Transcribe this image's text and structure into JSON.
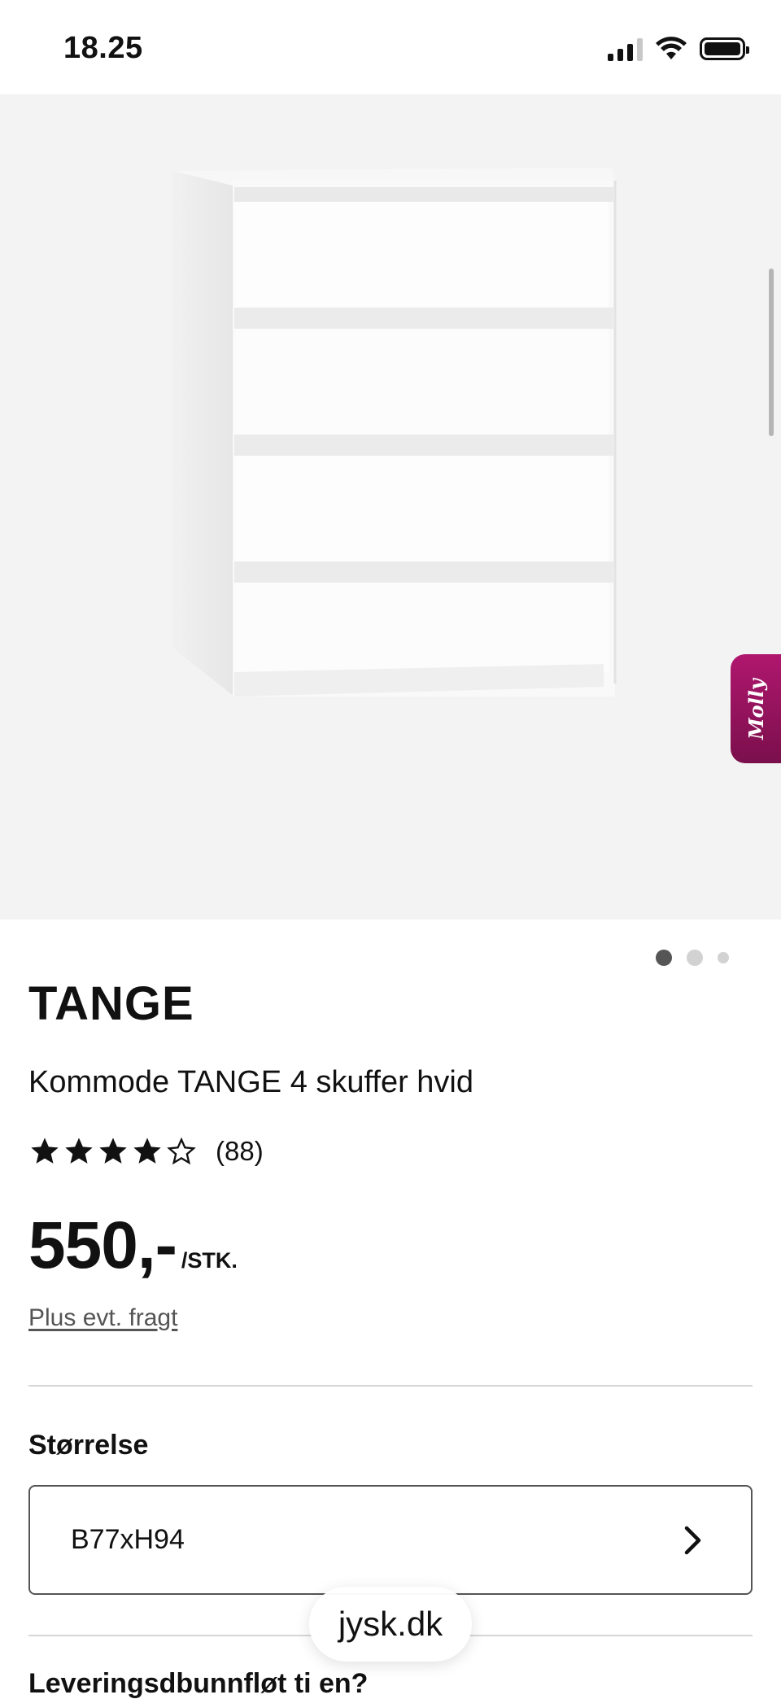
{
  "status_bar": {
    "time": "18.25",
    "battery_level": 1.0,
    "signal_bars_active": 3,
    "signal_bars_total": 4
  },
  "gallery": {
    "image_count": 3,
    "active_index": 0,
    "dot_colors": {
      "active": "#555555",
      "inactive": "#cfcfcf"
    },
    "chat_tab_label": "Molly",
    "chat_tab_color": "#9b1565"
  },
  "product": {
    "brand": "TANGE",
    "title": "Kommode TANGE 4 skuffer hvid",
    "rating": 4,
    "rating_max": 5,
    "review_count": "(88)",
    "price": "550,-",
    "unit": "/STK.",
    "freight_link": "Plus evt. fragt"
  },
  "size": {
    "label": "Størrelse",
    "value": "B77xH94",
    "chevron_icon": "chevron-right-icon"
  },
  "next_section": {
    "heading": "Leveringsdbunnfløt ti en?"
  },
  "browser": {
    "url": "jysk.dk"
  }
}
